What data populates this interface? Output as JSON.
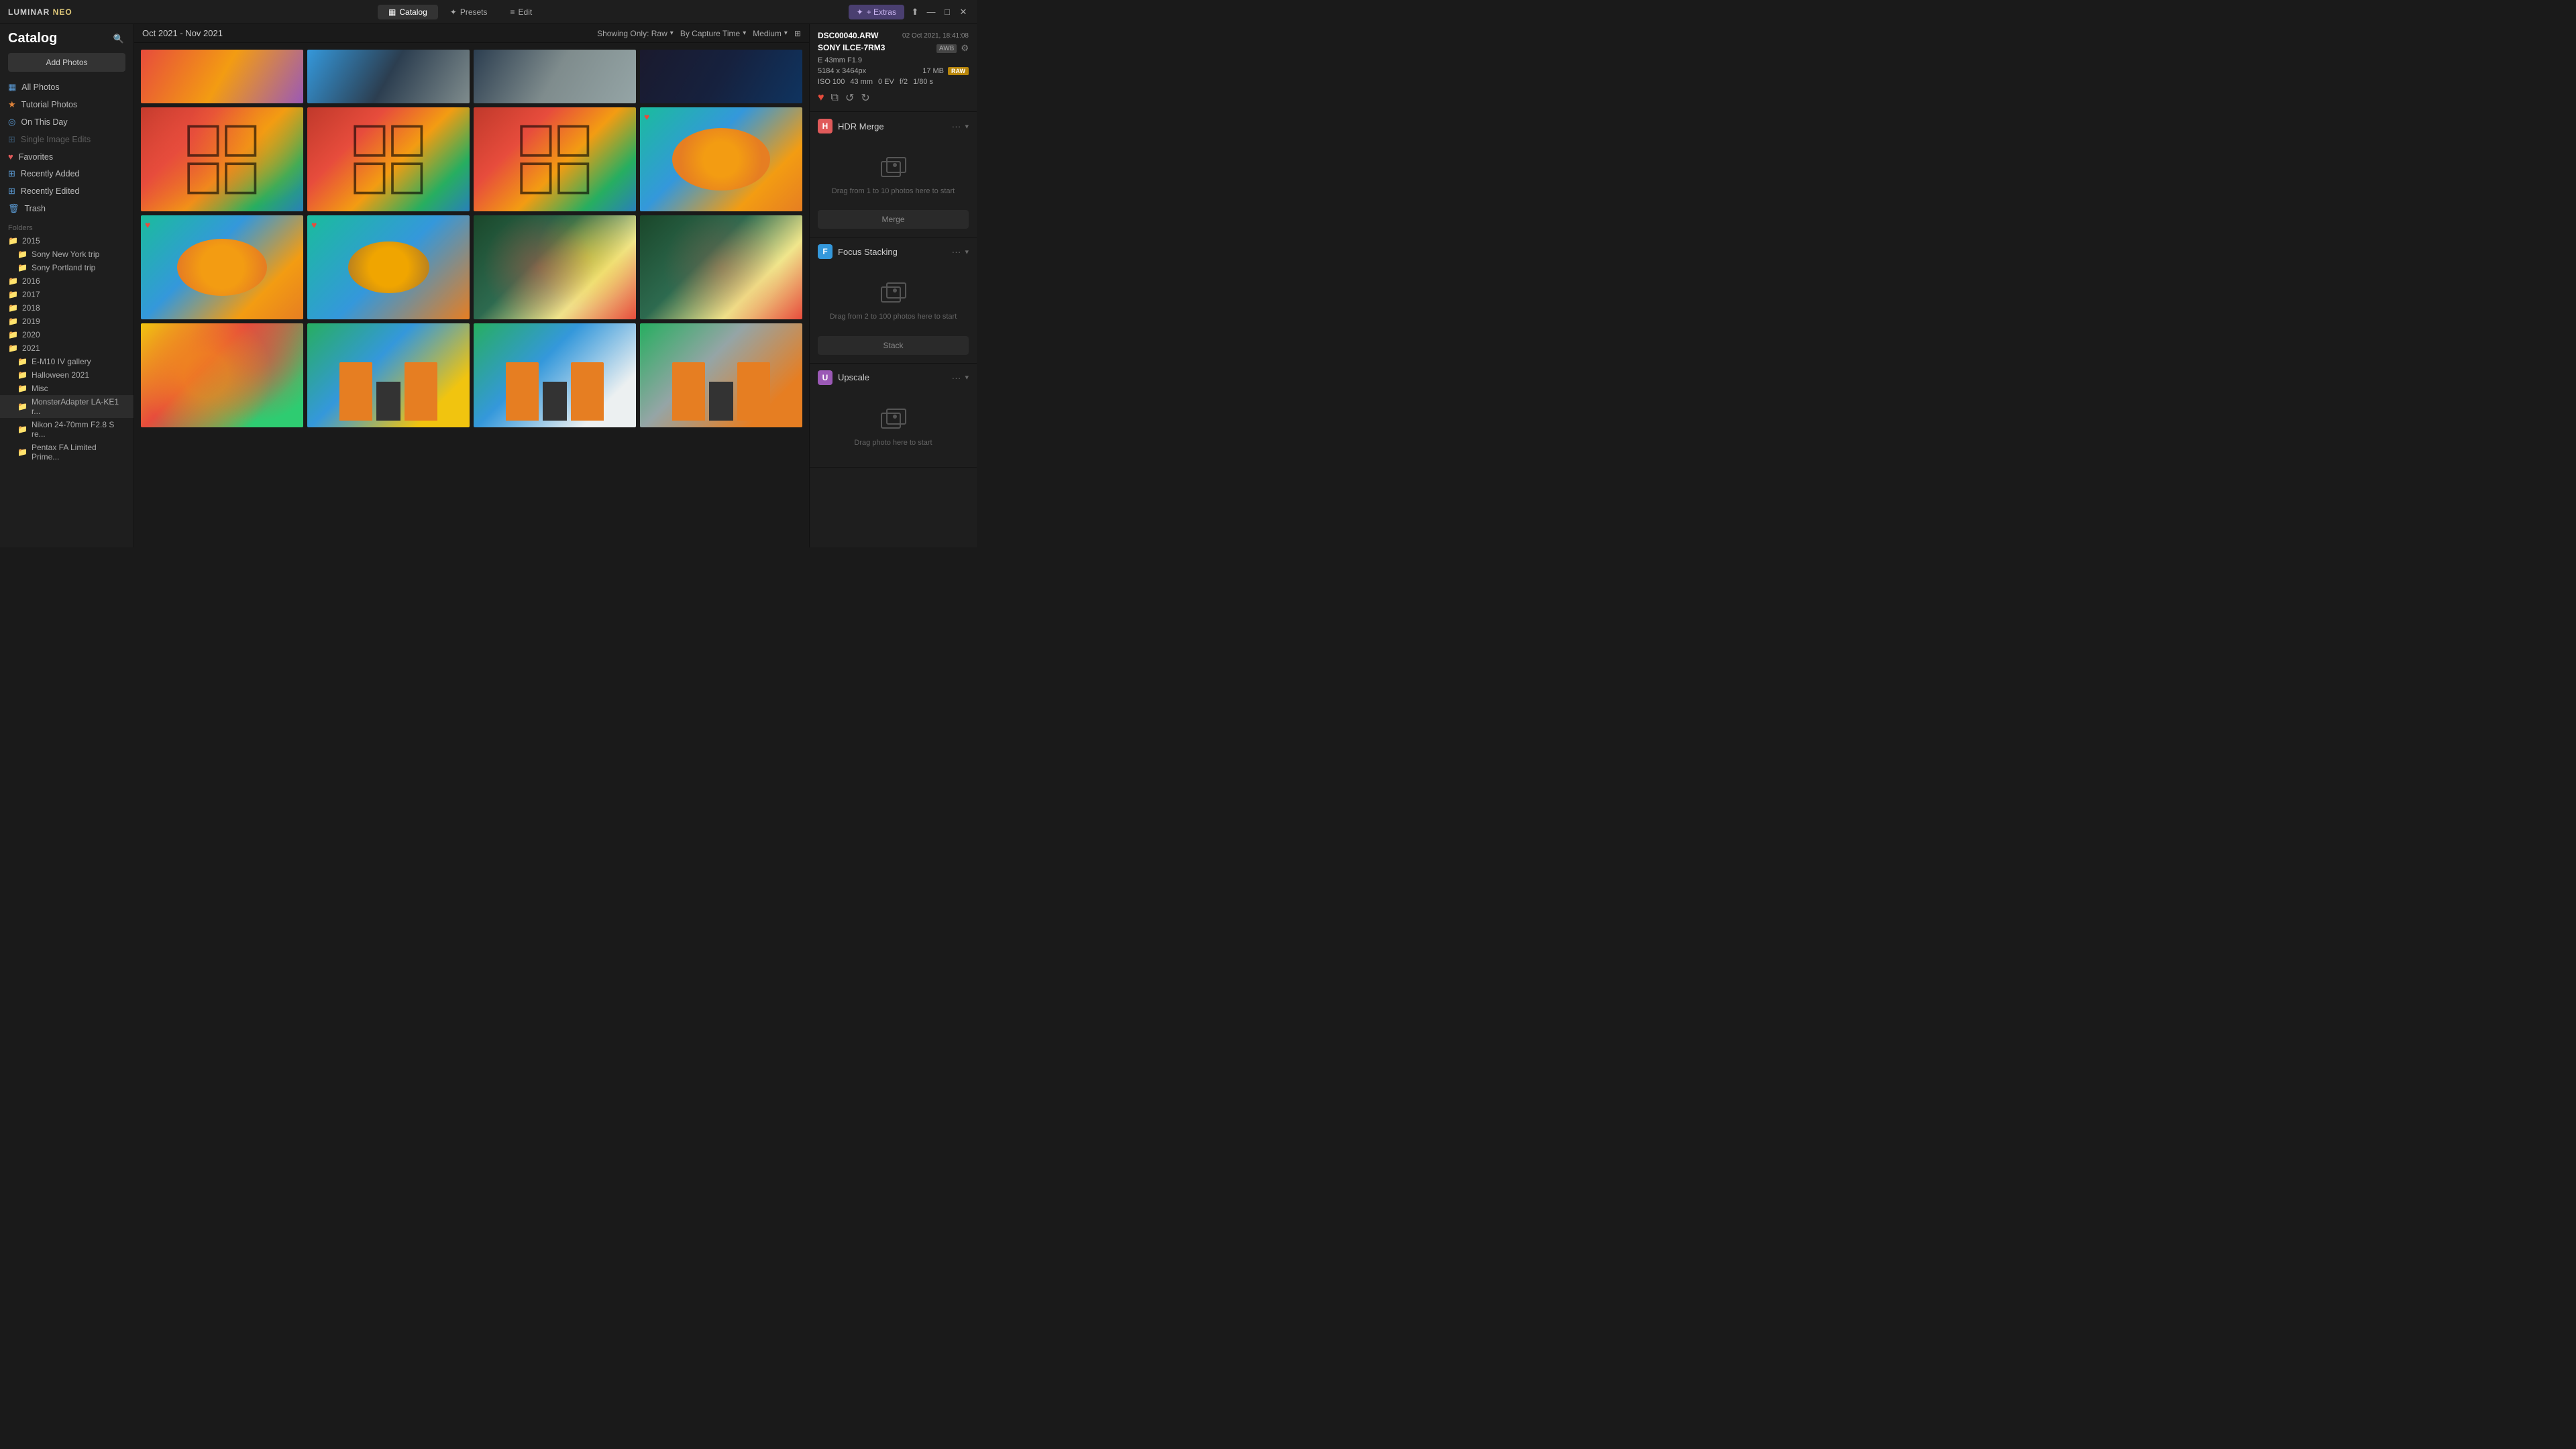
{
  "app": {
    "logo_text": "LUMINAR",
    "logo_neo": " NEO"
  },
  "titlebar": {
    "nav": [
      {
        "id": "catalog",
        "label": "Catalog",
        "icon": "▦",
        "active": true
      },
      {
        "id": "presets",
        "label": "Presets",
        "icon": "✦",
        "active": false
      },
      {
        "id": "edit",
        "label": "Edit",
        "icon": "≡",
        "active": false
      }
    ],
    "extras_label": "+ Extras",
    "win_buttons": [
      "share",
      "minimize",
      "maximize",
      "close"
    ]
  },
  "sidebar": {
    "title": "Catalog",
    "add_photos_label": "Add Photos",
    "items": [
      {
        "id": "all-photos",
        "label": "All Photos",
        "icon": "▦",
        "icon_color": "blue"
      },
      {
        "id": "tutorial-photos",
        "label": "Tutorial Photos",
        "icon": "★",
        "icon_color": "orange"
      },
      {
        "id": "on-this-day",
        "label": "On This Day",
        "icon": "◎",
        "icon_color": "blue"
      },
      {
        "id": "single-image-edits",
        "label": "Single Image Edits",
        "icon": "⊞",
        "icon_color": "blue",
        "disabled": true
      },
      {
        "id": "favorites",
        "label": "Favorites",
        "icon": "♥",
        "icon_color": "red"
      },
      {
        "id": "recently-added",
        "label": "Recently Added",
        "icon": "⊞",
        "icon_color": "blue"
      },
      {
        "id": "recently-edited",
        "label": "Recently Edited",
        "icon": "⊞",
        "icon_color": "blue"
      },
      {
        "id": "trash",
        "label": "Trash",
        "icon": "🗑",
        "icon_color": "blue"
      }
    ],
    "folders_label": "Folders",
    "folders": [
      {
        "id": "2015",
        "label": "2015",
        "indent": false
      },
      {
        "id": "sony-new-york",
        "label": "Sony New York trip",
        "indent": true
      },
      {
        "id": "sony-portland",
        "label": "Sony Portland trip",
        "indent": true
      },
      {
        "id": "2016",
        "label": "2016",
        "indent": false
      },
      {
        "id": "2017",
        "label": "2017",
        "indent": false
      },
      {
        "id": "2018",
        "label": "2018",
        "indent": false
      },
      {
        "id": "2019",
        "label": "2019",
        "indent": false
      },
      {
        "id": "2020",
        "label": "2020",
        "indent": false
      },
      {
        "id": "2021",
        "label": "2021",
        "indent": false
      },
      {
        "id": "e-m10",
        "label": "E-M10 IV gallery",
        "indent": true
      },
      {
        "id": "halloween",
        "label": "Halloween 2021",
        "indent": true
      },
      {
        "id": "misc",
        "label": "Misc",
        "indent": true
      },
      {
        "id": "monster-adapter",
        "label": "MonsterAdapter LA-KE1 r...",
        "indent": true,
        "active": true
      },
      {
        "id": "nikon",
        "label": "Nikon 24-70mm F2.8 S re...",
        "indent": true
      },
      {
        "id": "pentax",
        "label": "Pentax FA Limited Prime...",
        "indent": true
      }
    ]
  },
  "content": {
    "date_range": "Oct 2021 - Nov 2021",
    "showing_label": "Showing Only: Raw",
    "sort_label": "By Capture Time",
    "size_label": "Medium"
  },
  "file_info": {
    "filename": "DSC00040.ARW",
    "date": "02 Oct 2021, 18:41:08",
    "camera": "SONY ILCE-7RM3",
    "awb": "AWB",
    "focal_length_equiv": "E 43mm F1.9",
    "dimensions": "5184 x 3464px",
    "file_size": "17 MB",
    "iso": "ISO 100",
    "focal_mm": "43 mm",
    "ev": "0 EV",
    "aperture": "f/2",
    "shutter": "1/80 s",
    "format_badge": "RAW"
  },
  "tool_panels": [
    {
      "id": "hdr-merge",
      "icon": "H",
      "icon_color": "hdr",
      "name": "HDR Merge",
      "drop_text": "Drag from 1 to 10 photos here to start",
      "action_label": "Merge"
    },
    {
      "id": "focus-stacking",
      "icon": "F",
      "icon_color": "focus",
      "name": "Focus Stacking",
      "drop_text": "Drag from 2 to 100 photos here to start",
      "action_label": "Stack"
    },
    {
      "id": "upscale",
      "icon": "U",
      "icon_color": "upscale",
      "name": "Upscale",
      "drop_text": "Drag photo here to start",
      "action_label": null
    }
  ]
}
